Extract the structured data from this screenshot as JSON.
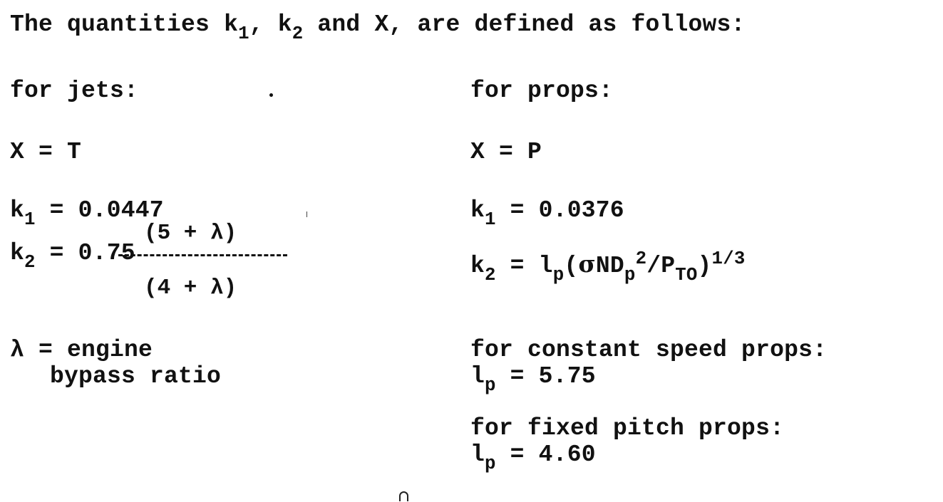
{
  "heading": {
    "prefix": "The quantities ",
    "k": "k",
    "sub1": "1",
    "sep": ", ",
    "sub2": "2",
    "suffix": " and X, are defined as follows:"
  },
  "jets": {
    "label": "for jets:",
    "x_eq": "X = T",
    "k1_lhs": "k",
    "k1_sub": "1",
    "k1_rhs": " = 0.0447",
    "k2_lhs": "k",
    "k2_sub": "2",
    "k2_rhs": " = 0.75",
    "frac_num": "(5 + λ)",
    "frac_den": "(4 + λ)",
    "lambda_line1": "λ = engine",
    "lambda_line2": "bypass ratio"
  },
  "props": {
    "label": "for props:",
    "x_eq": "X = P",
    "k1_lhs": "k",
    "k1_sub": "1",
    "k1_rhs": " = 0.0376",
    "k2_lhs": "k",
    "k2_sub": "2",
    "k2_eq": " = l",
    "k2_p": "p",
    "k2_open": "(",
    "k2_sigma": "σ",
    "k2_nd": "ND",
    "k2_dp": "p",
    "k2_sq": "2",
    "k2_slash": "/P",
    "k2_to": "TO",
    "k2_close": ")",
    "k2_exp": "1/3",
    "const_label": "for constant speed props:",
    "const_l": "l",
    "const_sub": "p",
    "const_val": " = 5.75",
    "fixed_label": "for fixed pitch props:",
    "fixed_l": "l",
    "fixed_sub": "p",
    "fixed_val": " = 4.60"
  }
}
